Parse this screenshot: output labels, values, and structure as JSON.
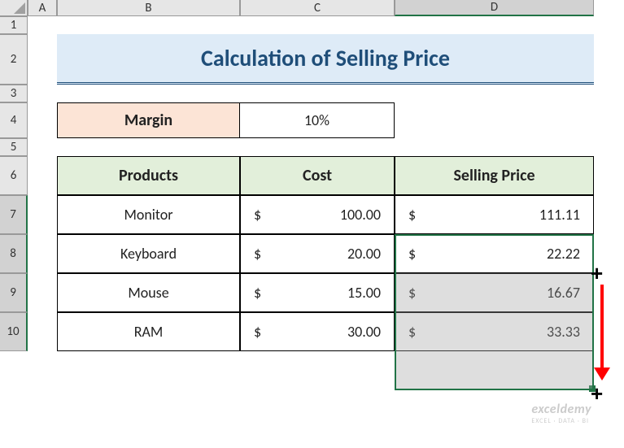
{
  "columns": [
    "A",
    "B",
    "C",
    "D"
  ],
  "rows": [
    "1",
    "2",
    "3",
    "4",
    "5",
    "6",
    "7",
    "8",
    "9",
    "10"
  ],
  "title": "Calculation of Selling Price",
  "margin": {
    "label": "Margin",
    "value": "10%"
  },
  "headers": {
    "products": "Products",
    "cost": "Cost",
    "selling": "Selling Price"
  },
  "currency": "$",
  "products": [
    {
      "name": "Monitor",
      "cost": "100.00",
      "price": "111.11"
    },
    {
      "name": "Keyboard",
      "cost": "20.00",
      "price": "22.22"
    },
    {
      "name": "Mouse",
      "cost": "15.00",
      "price": "16.67"
    },
    {
      "name": "RAM",
      "cost": "30.00",
      "price": "33.33"
    }
  ],
  "watermark": {
    "line1": "exceldemy",
    "line2": "EXCEL · DATA · BI"
  },
  "chart_data": {
    "type": "table",
    "title": "Calculation of Selling Price",
    "margin_pct": 10,
    "columns": [
      "Products",
      "Cost",
      "Selling Price"
    ],
    "rows": [
      [
        "Monitor",
        100.0,
        111.11
      ],
      [
        "Keyboard",
        20.0,
        22.22
      ],
      [
        "Mouse",
        15.0,
        16.67
      ],
      [
        "RAM",
        30.0,
        33.33
      ]
    ]
  }
}
